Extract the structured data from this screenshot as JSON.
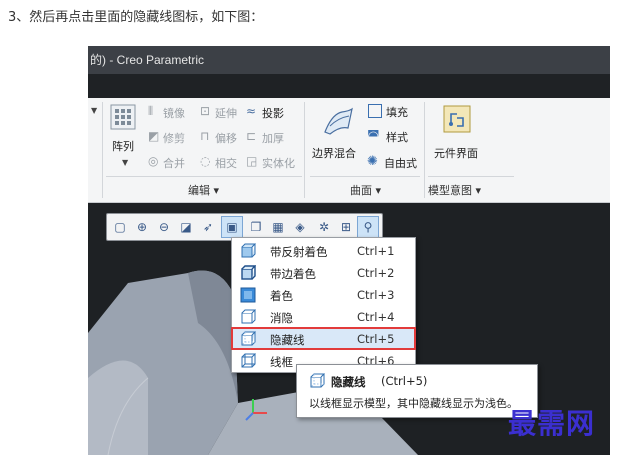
{
  "article": {
    "step_text": "3、然后再点击里面的隐藏线图标，如下图："
  },
  "window": {
    "title": "的) - Creo Parametric"
  },
  "ribbon": {
    "pattern_label": "阵列",
    "edit": {
      "mirror": "镜像",
      "extend": "延伸",
      "project": "投影",
      "trim": "修剪",
      "offset": "偏移",
      "thicken": "加厚",
      "merge": "合并",
      "intersect": "相交",
      "solidify": "实体化",
      "group_label": "编辑 ▾"
    },
    "surface": {
      "boundary_blend": "边界混合",
      "fill": "填充",
      "style": "样式",
      "freestyle": "自由式",
      "group_label": "曲面 ▾"
    },
    "model_intent": {
      "component_interface": "元件界面",
      "group_label": "模型意图 ▾"
    }
  },
  "display_menu": {
    "items": [
      {
        "label": "带反射着色",
        "shortcut": "Ctrl+1"
      },
      {
        "label": "带边着色",
        "shortcut": "Ctrl+2"
      },
      {
        "label": "着色",
        "shortcut": "Ctrl+3"
      },
      {
        "label": "消隐",
        "shortcut": "Ctrl+4"
      },
      {
        "label": "隐藏线",
        "shortcut": "Ctrl+5"
      },
      {
        "label": "线框",
        "shortcut": "Ctrl+6"
      }
    ],
    "highlighted_index": 4
  },
  "tooltip": {
    "title": "隐藏线",
    "shortcut": "(Ctrl+5)",
    "description": "以线框显示模型，其中隐藏线显示为浅色。"
  },
  "watermark": "最需网",
  "colors": {
    "highlight_border": "#e23b3b",
    "accent": "#3a7bd5",
    "watermark": "#3b2fd0"
  }
}
